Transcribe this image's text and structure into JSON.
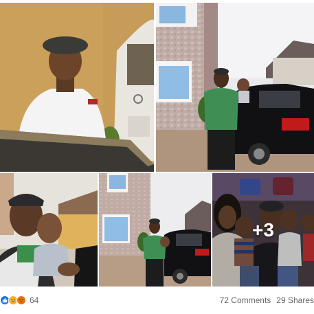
{
  "post": {
    "more_photos_label": "+3",
    "reaction_icons": [
      "like-icon",
      "sad-icon",
      "angry-icon"
    ],
    "reaction_count": "64",
    "comments": "72 Comments",
    "shares": "29 Shares"
  },
  "colors": {
    "like": "#1877f2",
    "sad": "#f7b125",
    "angry": "#e9710f"
  }
}
